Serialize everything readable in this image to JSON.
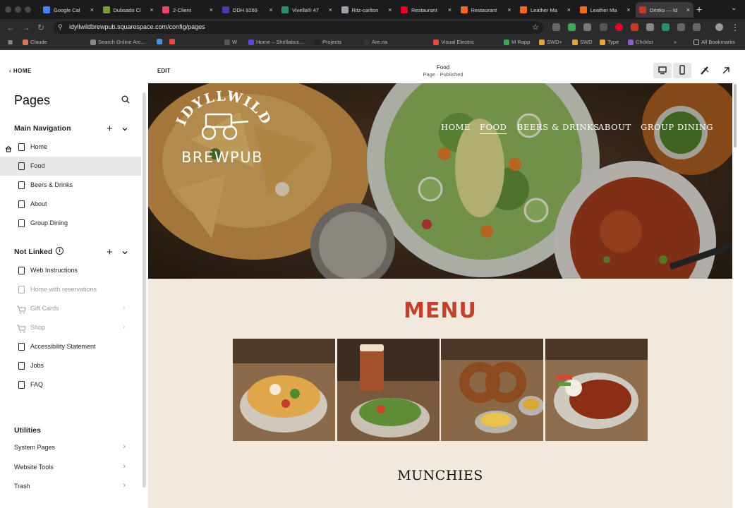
{
  "browser": {
    "tabs": [
      {
        "title": "Google Cal",
        "color": "#4285f4"
      },
      {
        "title": "Dubsado Cl",
        "color": "#7a9a3a"
      },
      {
        "title": "2-Client",
        "color": "#e8456b"
      },
      {
        "title": "ODH 9269",
        "color": "#4a3aa8"
      },
      {
        "title": "Vivella® 47",
        "color": "#2b8f6a"
      },
      {
        "title": "Ritz-carlton",
        "color": "#9aa0a6"
      },
      {
        "title": "Restaurant",
        "color": "#e60023"
      },
      {
        "title": "Restaurant",
        "color": "#f26b21"
      },
      {
        "title": "Leather Ma",
        "color": "#f26b21"
      },
      {
        "title": "Leather Ma",
        "color": "#f26b21"
      },
      {
        "title": "Drinks — Id",
        "color": "#c23b22",
        "active": true
      }
    ],
    "new_tab": "+",
    "url": "idyllwildbrewpub.squarespace.com/config/pages",
    "bookmarks": [
      {
        "label": "Claude",
        "color": "#d97757"
      },
      {
        "label": "Search Online Arc...",
        "color": "#888888"
      },
      {
        "label": "",
        "color": "#4a90d9"
      },
      {
        "label": "",
        "color": "#e84b3c"
      },
      {
        "label": "W",
        "color": "#555555"
      },
      {
        "label": "Home – Shellabuc...",
        "color": "#5b4bd6"
      },
      {
        "label": "Projects",
        "color": "#222222"
      },
      {
        "label": "Are.na",
        "color": "#333333"
      },
      {
        "label": "Visual Electric",
        "color": "#e84b3c"
      },
      {
        "label": "M Rapp",
        "color": "#3aa857"
      },
      {
        "label": "SWD+",
        "color": "#e8a33c"
      },
      {
        "label": "SWD",
        "color": "#e8a33c"
      },
      {
        "label": "Type",
        "color": "#e8a33c"
      },
      {
        "label": "Chcklst",
        "color": "#8e5bd6"
      }
    ],
    "all_bookmarks": "All Bookmarks"
  },
  "sidebar": {
    "back_label": "HOME",
    "title": "Pages",
    "main_nav": {
      "heading": "Main Navigation",
      "items": [
        {
          "label": "Home",
          "is_homepage": true
        },
        {
          "label": "Food",
          "selected": true
        },
        {
          "label": "Beers & Drinks"
        },
        {
          "label": "About"
        },
        {
          "label": "Group Dining"
        }
      ]
    },
    "not_linked": {
      "heading": "Not Linked",
      "items": [
        {
          "label": "Web Instructions",
          "type": "page"
        },
        {
          "label": "Home with reservations",
          "type": "page",
          "disabled": true
        },
        {
          "label": "Gift Cards",
          "type": "store",
          "disabled": true
        },
        {
          "label": "Shop",
          "type": "store",
          "disabled": true
        },
        {
          "label": "Accessibility Statement",
          "type": "page"
        },
        {
          "label": "Jobs",
          "type": "page"
        },
        {
          "label": "FAQ",
          "type": "page"
        }
      ]
    },
    "utilities": {
      "heading": "Utilities",
      "items": [
        {
          "label": "System Pages"
        },
        {
          "label": "Website Tools"
        },
        {
          "label": "Trash"
        }
      ]
    }
  },
  "editor": {
    "edit_label": "EDIT",
    "page_name": "Food",
    "page_status": "Page · Published"
  },
  "site": {
    "logo_top": "IDYLLWILD",
    "logo_bottom": "BREWPUB",
    "nav": [
      {
        "label": "HOME"
      },
      {
        "label": "FOOD",
        "active": true
      },
      {
        "label": "BEERS & DRINKS"
      },
      {
        "label": "ABOUT"
      },
      {
        "label": "GROUP DINING"
      }
    ],
    "menu_heading": "MENU",
    "section_heading": "MUNCHIES",
    "accent_color": "#c2412d",
    "background_color": "#f1e9dd"
  }
}
